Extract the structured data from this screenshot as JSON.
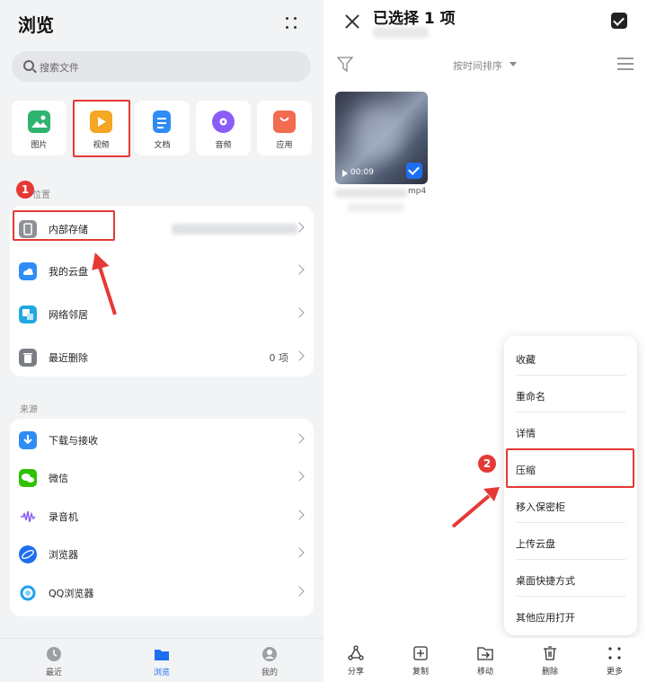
{
  "left": {
    "title": "浏览",
    "search_placeholder": "搜索文件",
    "categories": [
      {
        "label": "图片",
        "icon": "image-icon",
        "color": "#2fb36f"
      },
      {
        "label": "视频",
        "icon": "video-icon",
        "color": "#f5a623"
      },
      {
        "label": "文档",
        "icon": "document-icon",
        "color": "#2f8cf5"
      },
      {
        "label": "音频",
        "icon": "audio-icon",
        "color": "#8b5cf6"
      },
      {
        "label": "应用",
        "icon": "app-icon",
        "color": "#f26c4f"
      }
    ],
    "step1": "1",
    "location_section": "位置",
    "locations": [
      {
        "label": "内部存储",
        "icon": "phone-storage-icon",
        "color": "#8e9297",
        "value": ""
      },
      {
        "label": "我的云盘",
        "icon": "cloud-drive-icon",
        "color": "#2f8cf5",
        "value": ""
      },
      {
        "label": "网络邻居",
        "icon": "network-icon",
        "color": "#22a8e0",
        "value": ""
      },
      {
        "label": "最近删除",
        "icon": "trash-icon",
        "color": "#7a7e84",
        "value": "0 项"
      }
    ],
    "source_section": "来源",
    "sources": [
      {
        "label": "下载与接收",
        "icon": "download-icon",
        "color": "#2f8cf5"
      },
      {
        "label": "微信",
        "icon": "wechat-icon",
        "color": "#2dc100"
      },
      {
        "label": "录音机",
        "icon": "recorder-icon",
        "color": "#8b5cf6"
      },
      {
        "label": "浏览器",
        "icon": "browser-icon",
        "color": "#1e6ff0"
      },
      {
        "label": "QQ浏览器",
        "icon": "qq-browser-icon",
        "color": "#1fa0f0"
      }
    ],
    "tabs": [
      {
        "label": "最近",
        "icon": "clock-icon",
        "active": false
      },
      {
        "label": "浏览",
        "icon": "folder-icon",
        "active": true
      },
      {
        "label": "我的",
        "icon": "profile-icon",
        "active": false
      }
    ],
    "accent": "#1e6ff0",
    "highlight_color": "#e53935"
  },
  "right": {
    "title": "已选择 1 项",
    "sort_label": "按时间排序",
    "file": {
      "duration": "00:09",
      "extension": "mp4",
      "selected": true
    },
    "menu": [
      "收藏",
      "重命名",
      "详情",
      "压缩",
      "移入保密柜",
      "上传云盘",
      "桌面快捷方式",
      "其他应用打开"
    ],
    "step2": "2",
    "toolbar": [
      {
        "label": "分享",
        "icon": "share-icon"
      },
      {
        "label": "复制",
        "icon": "copy-icon"
      },
      {
        "label": "移动",
        "icon": "move-icon"
      },
      {
        "label": "删除",
        "icon": "delete-icon"
      },
      {
        "label": "更多",
        "icon": "more-icon"
      }
    ]
  }
}
